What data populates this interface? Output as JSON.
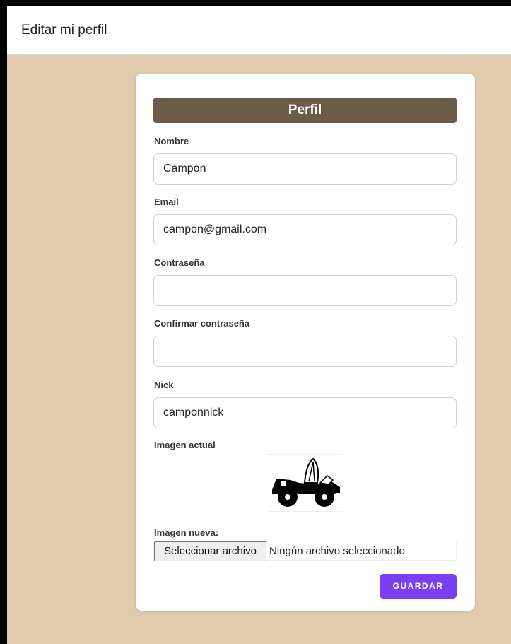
{
  "topbar": {
    "title": "Editar mi perfil"
  },
  "card": {
    "header": "Perfil",
    "fields": {
      "nombre": {
        "label": "Nombre",
        "value": "Campon"
      },
      "email": {
        "label": "Email",
        "value": "campon@gmail.com"
      },
      "password": {
        "label": "Contraseña",
        "value": ""
      },
      "confirm": {
        "label": "Confirmar contraseña",
        "value": ""
      },
      "nick": {
        "label": "Nick",
        "value": "camponnick"
      }
    },
    "current_image": {
      "label": "Imagen actual",
      "icon": "car-avatar-icon"
    },
    "new_image": {
      "label": "Imagen nueva:",
      "button": "Seleccionar archivo",
      "status": "Ningún archivo seleccionado"
    },
    "save_label": "GUARDAR"
  },
  "colors": {
    "background": "#e0cbae",
    "header": "#6c5b46",
    "accent": "#7b3ff0"
  }
}
